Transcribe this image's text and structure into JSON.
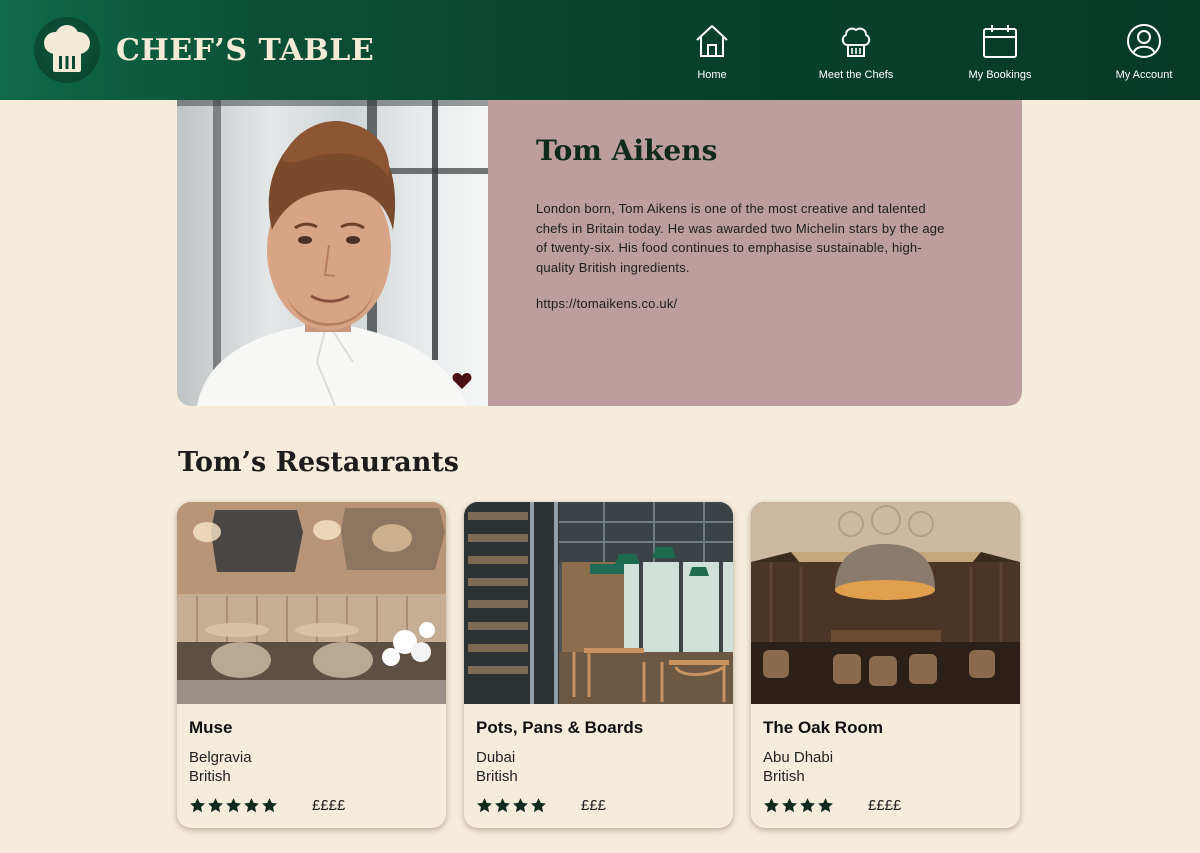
{
  "header": {
    "brand_title": "CHEF’S TABLE",
    "brand_icon": "chef-hat-icon",
    "nav": [
      {
        "label": "Home",
        "icon": "home-icon"
      },
      {
        "label": "Meet the Chefs",
        "icon": "chef-hat-icon"
      },
      {
        "label": "My Bookings",
        "icon": "calendar-icon"
      },
      {
        "label": "My Account",
        "icon": "user-circle-icon"
      }
    ]
  },
  "chef": {
    "name": "Tom Aikens",
    "bio": "London born, Tom Aikens is one of the most creative and talented chefs in Britain today. He was awarded two Michelin stars by the age of twenty-six. His food continues to emphasise sustainable, high-quality British ingredients.",
    "website": "https://tomaikens.co.uk/",
    "favorite_icon": "heart-icon"
  },
  "restaurants_section": {
    "title": "Tom’s Restaurants",
    "items": [
      {
        "name": "Muse",
        "location": "Belgravia",
        "cuisine": "British",
        "rating": 5,
        "price": "££££"
      },
      {
        "name": "Pots, Pans & Boards",
        "location": "Dubai",
        "cuisine": "British",
        "rating": 4,
        "price": "£££"
      },
      {
        "name": "The Oak Room",
        "location": "Abu Dhabi",
        "cuisine": "British",
        "rating": 4,
        "price": "££££"
      }
    ]
  },
  "colors": {
    "header_green": "#08402b",
    "background_cream": "#f6ecdc",
    "bio_panel_rose": "#bb9e9d",
    "star_green": "#10291d",
    "heart": "#4a0f12"
  }
}
